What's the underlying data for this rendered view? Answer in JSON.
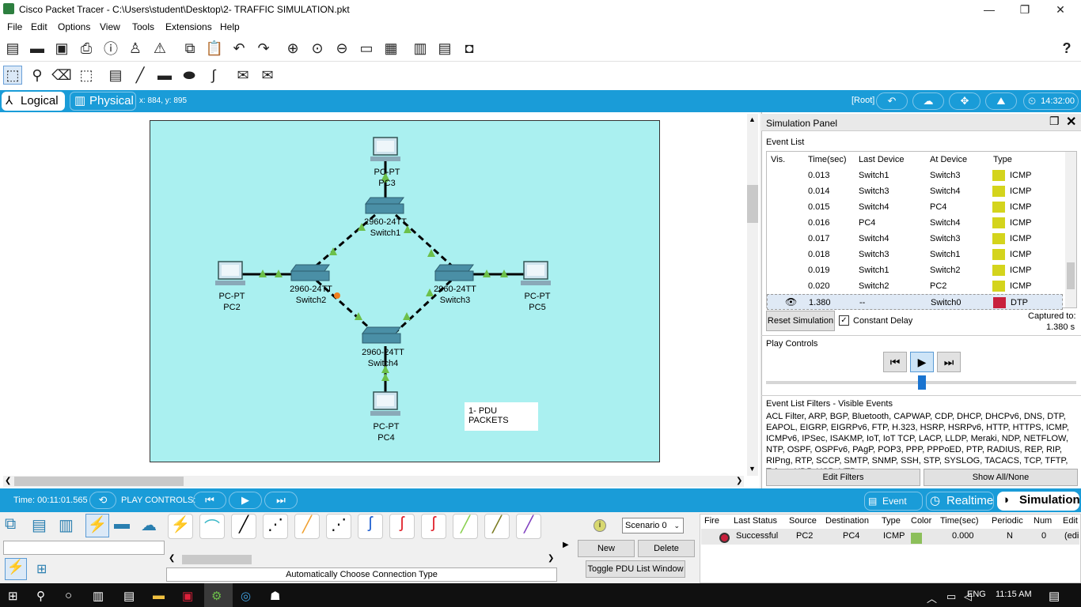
{
  "window": {
    "title": "Cisco Packet Tracer - C:\\Users\\student\\Desktop\\2- TRAFFIC SIMULATION.pkt",
    "minimize": "—",
    "maximize": "❐",
    "close": "✕"
  },
  "menu": [
    "File",
    "Edit",
    "Options",
    "View",
    "Tools",
    "Extensions",
    "Help"
  ],
  "toolbar": {
    "help": "?"
  },
  "bluebar": {
    "logical": "Logical",
    "physical": "Physical",
    "coords": "x: 884, y: 895",
    "root": "[Root]",
    "clock": "14:32:00"
  },
  "devices": [
    {
      "model": "PC-PT",
      "name": "PC3"
    },
    {
      "model": "2960-24TT",
      "name": "Switch1"
    },
    {
      "model": "PC-PT",
      "name": "PC2"
    },
    {
      "model": "2960-24TT",
      "name": "Switch2"
    },
    {
      "model": "2960-24TT",
      "name": "Switch3"
    },
    {
      "model": "PC-PT",
      "name": "PC5"
    },
    {
      "model": "2960-24TT",
      "name": "Switch4"
    },
    {
      "model": "PC-PT",
      "name": "PC4"
    }
  ],
  "note": "1- PDU PACKETS",
  "sim_panel": {
    "title": "Simulation Panel",
    "event_list_label": "Event List",
    "columns": [
      "Vis.",
      "Time(sec)",
      "Last Device",
      "At Device",
      "Type"
    ],
    "events": [
      {
        "time": "0.013",
        "last": "Switch1",
        "at": "Switch3",
        "type": "ICMP",
        "color": "#d4d41c"
      },
      {
        "time": "0.014",
        "last": "Switch3",
        "at": "Switch4",
        "type": "ICMP",
        "color": "#d4d41c"
      },
      {
        "time": "0.015",
        "last": "Switch4",
        "at": "PC4",
        "type": "ICMP",
        "color": "#d4d41c"
      },
      {
        "time": "0.016",
        "last": "PC4",
        "at": "Switch4",
        "type": "ICMP",
        "color": "#d4d41c"
      },
      {
        "time": "0.017",
        "last": "Switch4",
        "at": "Switch3",
        "type": "ICMP",
        "color": "#d4d41c"
      },
      {
        "time": "0.018",
        "last": "Switch3",
        "at": "Switch1",
        "type": "ICMP",
        "color": "#d4d41c"
      },
      {
        "time": "0.019",
        "last": "Switch1",
        "at": "Switch2",
        "type": "ICMP",
        "color": "#d4d41c"
      },
      {
        "time": "0.020",
        "last": "Switch2",
        "at": "PC2",
        "type": "ICMP",
        "color": "#d4d41c"
      },
      {
        "time": "1.380",
        "last": "--",
        "at": "Switch0",
        "type": "DTP",
        "color": "#c8203c"
      }
    ],
    "reset": "Reset Simulation",
    "constant_delay": "Constant Delay",
    "captured_label": "Captured to:",
    "captured_value": "1.380 s",
    "play_controls": "Play Controls",
    "filters_title": "Event List Filters - Visible Events",
    "filters_text": "ACL Filter, ARP, BGP, Bluetooth, CAPWAP, CDP, DHCP, DHCPv6, DNS, DTP, EAPOL, EIGRP, EIGRPv6, FTP, H.323, HSRP, HSRPv6, HTTP, HTTPS, ICMP, ICMPv6, IPSec, ISAKMP, IoT, IoT TCP, LACP, LLDP, Meraki, NDP, NETFLOW, NTP, OSPF, OSPFv6, PAgP, POP3, PPP, PPPoED, PTP, RADIUS, REP, RIP, RIPng, RTP, SCCP, SMTP, SNMP, SSH, STP, SYSLOG, TACACS, TCP, TFTP, Telnet, UDP, USB, VTP",
    "edit_filters": "Edit Filters",
    "show_all": "Show All/None"
  },
  "bottom": {
    "time": "Time: 00:11:01.565",
    "play_controls": "PLAY CONTROLS:",
    "event_list": "Event List",
    "realtime": "Realtime",
    "simulation": "Simulation"
  },
  "devicebar": {
    "connection_type": "Automatically Choose Connection Type"
  },
  "scenario": {
    "selected": "Scenario 0",
    "new": "New",
    "delete": "Delete",
    "toggle": "Toggle PDU List Window"
  },
  "pdu_list": {
    "columns": [
      "Fire",
      "Last Status",
      "Source",
      "Destination",
      "Type",
      "Color",
      "Time(sec)",
      "Periodic",
      "Num",
      "Edit"
    ],
    "rows": [
      {
        "status": "Successful",
        "source": "PC2",
        "destination": "PC4",
        "type": "ICMP",
        "color": "#8cbf5a",
        "time": "0.000",
        "periodic": "N",
        "num": "0",
        "edit": "(edi"
      }
    ]
  },
  "taskbar": {
    "lang": "ENG",
    "time": "11:15 AM"
  }
}
